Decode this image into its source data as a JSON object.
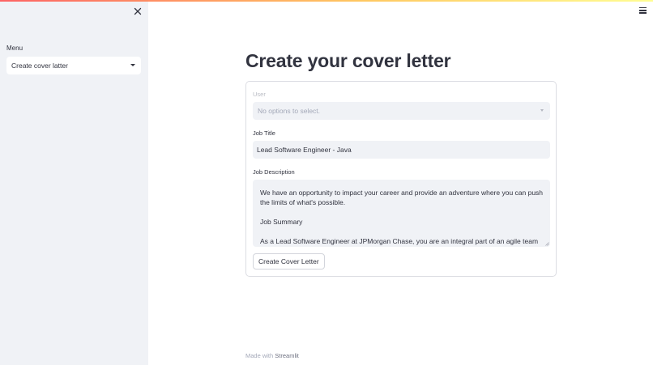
{
  "sidebar": {
    "menu_label": "Menu",
    "menu_selected": "Create cover latter"
  },
  "main": {
    "title": "Create your cover letter",
    "user_label": "User",
    "user_placeholder": "No options to select.",
    "job_title_label": "Job Title",
    "job_title_value": "Lead Software Engineer - Java",
    "job_description_label": "Job Description",
    "job_description_lines": [
      "We have an opportunity to impact your career and provide an adventure where you can push",
      "the limits of what's possible.",
      "Job Summary",
      "As a Lead Software Engineer at JPMorgan Chase, you are an integral part of an agile team that"
    ],
    "submit_label": "Create Cover Letter"
  },
  "footer": {
    "prefix": "Made with",
    "brand": "Streamlit"
  },
  "colors": {
    "sidebar_bg": "#f0f2f6",
    "text": "#31333f",
    "accent_gradient_start": "#ff4b4b",
    "accent_gradient_end": "#fffd80"
  },
  "icons": [
    "close-icon",
    "chevron-down-icon",
    "hamburger-menu-icon",
    "resize-handle-icon"
  ]
}
